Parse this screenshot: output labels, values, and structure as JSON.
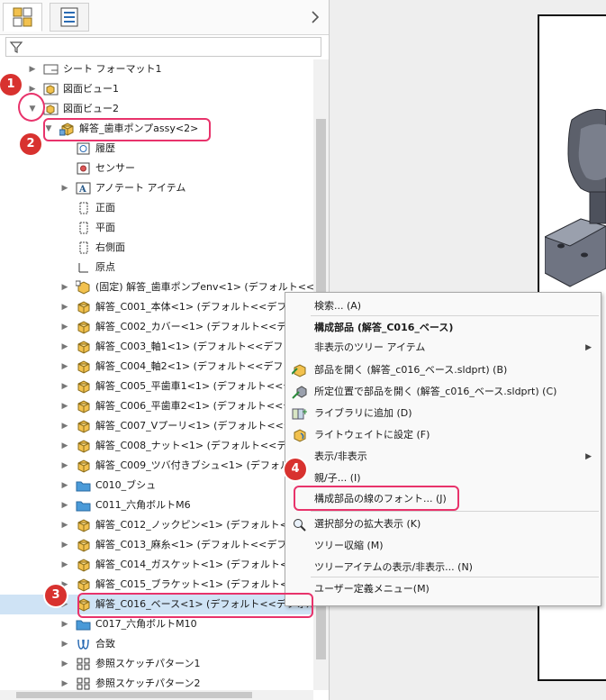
{
  "tabs": [
    {
      "name": "featuremanager-tab",
      "icon": "featuremanager-tree-icon"
    },
    {
      "name": "propertymanager-tab",
      "icon": "property-list-icon"
    }
  ],
  "tabbar": {
    "more_icon": "chevron-right-icon"
  },
  "filter": {
    "icon": "filter-icon",
    "value": ""
  },
  "tree": [
    {
      "label": "シート フォーマット1",
      "icon": "sheet-format-icon",
      "arrow": "▶",
      "indent": 0
    },
    {
      "label": "図面ビュー1",
      "icon": "drawing-view-icon",
      "arrow": "▶",
      "indent": 0
    },
    {
      "label": "図面ビュー2",
      "icon": "drawing-view-icon",
      "arrow": "▼",
      "indent": 0
    },
    {
      "label": "解答_歯車ポンプassy<2>",
      "icon": "assembly-icon",
      "arrow": "▼",
      "indent": 1
    },
    {
      "label": "履歴",
      "icon": "history-icon",
      "arrow": "",
      "indent": 2
    },
    {
      "label": "センサー",
      "icon": "sensor-icon",
      "arrow": "",
      "indent": 2
    },
    {
      "label": "アノテート アイテム",
      "icon": "annotation-icon",
      "arrow": "▶",
      "indent": 2
    },
    {
      "label": "正面",
      "icon": "plane-icon",
      "arrow": "",
      "indent": 2
    },
    {
      "label": "平面",
      "icon": "plane-icon",
      "arrow": "",
      "indent": 2
    },
    {
      "label": "右側面",
      "icon": "plane-icon",
      "arrow": "",
      "indent": 2
    },
    {
      "label": "原点",
      "icon": "origin-icon",
      "arrow": "",
      "indent": 2
    },
    {
      "label": "(固定) 解答_歯車ポンプenv<1> (デフォルト<<デ",
      "icon": "fixed-part-icon",
      "arrow": "▶",
      "indent": 2
    },
    {
      "label": "解答_C001_本体<1> (デフォルト<<デフォル",
      "icon": "part-icon",
      "arrow": "▶",
      "indent": 2
    },
    {
      "label": "解答_C002_カバー<1> (デフォルト<<デフォ",
      "icon": "part-icon",
      "arrow": "▶",
      "indent": 2
    },
    {
      "label": "解答_C003_軸1<1> (デフォルト<<デフォル",
      "icon": "part-icon",
      "arrow": "▶",
      "indent": 2
    },
    {
      "label": "解答_C004_軸2<1> (デフォルト<<デフォル",
      "icon": "part-icon",
      "arrow": "▶",
      "indent": 2
    },
    {
      "label": "解答_C005_平歯車1<1> (デフォルト<<デ",
      "icon": "part-icon",
      "arrow": "▶",
      "indent": 2
    },
    {
      "label": "解答_C006_平歯車2<1> (デフォルト<<デ",
      "icon": "part-icon",
      "arrow": "▶",
      "indent": 2
    },
    {
      "label": "解答_C007_Vプーリ<1> (デフォルト<<デフ",
      "icon": "part-icon",
      "arrow": "▶",
      "indent": 2
    },
    {
      "label": "解答_C008_ナット<1> (デフォルト<<デフ",
      "icon": "part-icon",
      "arrow": "▶",
      "indent": 2
    },
    {
      "label": "解答_C009_ツバ付きブシュ<1> (デフォルト<",
      "icon": "part-icon",
      "arrow": "▶",
      "indent": 2
    },
    {
      "label": "C010_ブシュ",
      "icon": "folder-icon",
      "arrow": "▶",
      "indent": 2
    },
    {
      "label": "C011_六角ボルトM6",
      "icon": "folder-icon",
      "arrow": "▶",
      "indent": 2
    },
    {
      "label": "解答_C012_ノックピン<1> (デフォルト<<デ",
      "icon": "part-icon",
      "arrow": "▶",
      "indent": 2
    },
    {
      "label": "解答_C013_麻糸<1> (デフォルト<<デフォル",
      "icon": "part-icon",
      "arrow": "▶",
      "indent": 2
    },
    {
      "label": "解答_C014_ガスケット<1> (デフォルト<<デ",
      "icon": "part-icon",
      "arrow": "▶",
      "indent": 2
    },
    {
      "label": "解答_C015_ブラケット<1> (デフォルト<<デ",
      "icon": "part-icon",
      "arrow": "▶",
      "indent": 2
    },
    {
      "label": "解答_C016_ベース<1> (デフォルト<<デフォルト>_表",
      "icon": "part-icon",
      "arrow": "▶",
      "indent": 2,
      "selected": true
    },
    {
      "label": "C017_六角ボルトM10",
      "icon": "folder-icon",
      "arrow": "▶",
      "indent": 2
    },
    {
      "label": "合致",
      "icon": "mates-icon",
      "arrow": "▶",
      "indent": 2
    },
    {
      "label": "参照スケッチパターン1",
      "icon": "pattern-icon",
      "arrow": "▶",
      "indent": 2
    },
    {
      "label": "参照スケッチパターン2",
      "icon": "pattern-icon",
      "arrow": "▶",
      "indent": 2
    }
  ],
  "context_menu": {
    "items": [
      {
        "label": "検索... (A)",
        "icon": "",
        "submenu": false,
        "bold": false
      },
      {
        "label": "構成部品 (解答_C016_ベース)",
        "icon": "",
        "submenu": false,
        "bold": true
      },
      {
        "label": "非表示のツリー アイテム",
        "icon": "",
        "submenu": true,
        "bold": false
      },
      {
        "label": "部品を開く (解答_c016_ベース.sldprt) (B)",
        "icon": "open-part-icon",
        "submenu": false,
        "bold": false
      },
      {
        "label": "所定位置で部品を開く (解答_c016_ベース.sldprt) (C)",
        "icon": "open-in-context-icon",
        "submenu": false,
        "bold": false
      },
      {
        "label": "ライブラリに追加 (D)",
        "icon": "add-to-library-icon",
        "submenu": false,
        "bold": false
      },
      {
        "label": "ライトウェイトに設定 (F)",
        "icon": "lightweight-icon",
        "submenu": false,
        "bold": false
      },
      {
        "label": "表示/非表示",
        "icon": "",
        "submenu": true,
        "bold": false
      },
      {
        "label": "親/子... (I)",
        "icon": "",
        "submenu": false,
        "bold": false
      },
      {
        "label": "構成部品の線のフォント... (J)",
        "icon": "",
        "submenu": false,
        "bold": false
      },
      {
        "label": "選択部分の拡大表示 (K)",
        "icon": "zoom-selection-icon",
        "submenu": false,
        "bold": false
      },
      {
        "label": "ツリー収縮 (M)",
        "icon": "",
        "submenu": false,
        "bold": false
      },
      {
        "label": "ツリーアイテムの表示/非表示... (N)",
        "icon": "",
        "submenu": false,
        "bold": false
      },
      {
        "label": "ユーザー定義メニュー(M)",
        "icon": "",
        "submenu": false,
        "bold": false
      }
    ]
  },
  "annotations": [
    {
      "label": "1",
      "target": "expand-arrow-drawing-view-2"
    },
    {
      "label": "2",
      "target": "assembly-node"
    },
    {
      "label": "3",
      "target": "selected-component"
    },
    {
      "label": "4",
      "target": "line-font-menu-item"
    }
  ],
  "colors": {
    "badge": "#d8322f",
    "highlight": "#e8336b",
    "selection": "#cfe3f5",
    "part_icon": "#f2c14e",
    "folder_icon": "#4a9ad8"
  }
}
